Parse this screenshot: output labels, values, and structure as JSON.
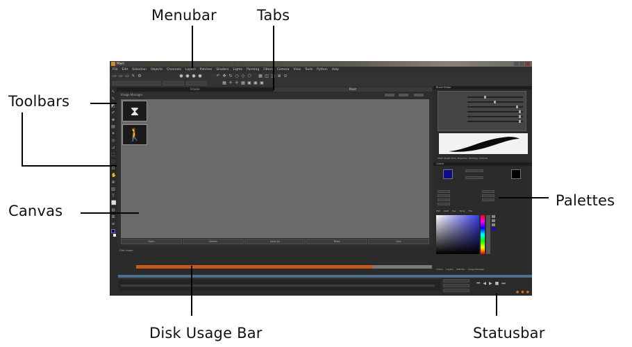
{
  "callouts": {
    "menubar": "Menubar",
    "tabs": "Tabs",
    "toolbars": "Toolbars",
    "canvas": "Canvas",
    "palettes": "Palettes",
    "disk_usage_bar": "Disk Usage Bar",
    "statusbar": "Statusbar"
  },
  "app": {
    "title": "Mari",
    "menu": [
      "File",
      "Edit",
      "Selection",
      "Objects",
      "Channels",
      "Layers",
      "Patches",
      "Shaders",
      "Lights",
      "Painting",
      "Filters",
      "Camera",
      "View",
      "Tools",
      "Python",
      "Help"
    ],
    "tabs": [
      {
        "label": "Shader",
        "active": false
      },
      {
        "label": "Paint",
        "active": true
      }
    ],
    "canvas_header": "Image Manager",
    "thumbnails": [
      {
        "label": "",
        "icon": "⧗"
      },
      {
        "label": "",
        "icon": "🚶"
      }
    ],
    "canvas_buttons": [
      "Open",
      "Delete",
      "Save All",
      "Filter",
      "Sort"
    ],
    "disk_label": "Disk Usage",
    "disk_usage_fraction": 0.8,
    "disk_fill_text": "",
    "palette_head_1": "Brush Editor",
    "palette_head_2": "Colors",
    "brush_tabs": [
      "Shelf",
      "Brush Tools",
      "Projection",
      "Painting",
      "Controls"
    ],
    "color_tabs": [
      "HSV",
      "RGB",
      "Hex",
      "Temp",
      "HSL"
    ],
    "bottom_tabs": [
      "Colors",
      "Layers",
      "Patches",
      "Image Manager"
    ],
    "colors": {
      "foreground": "#0b0b8c",
      "background": "#000000",
      "accent": "#c65a16",
      "timeline": "#4e6e8e"
    }
  }
}
